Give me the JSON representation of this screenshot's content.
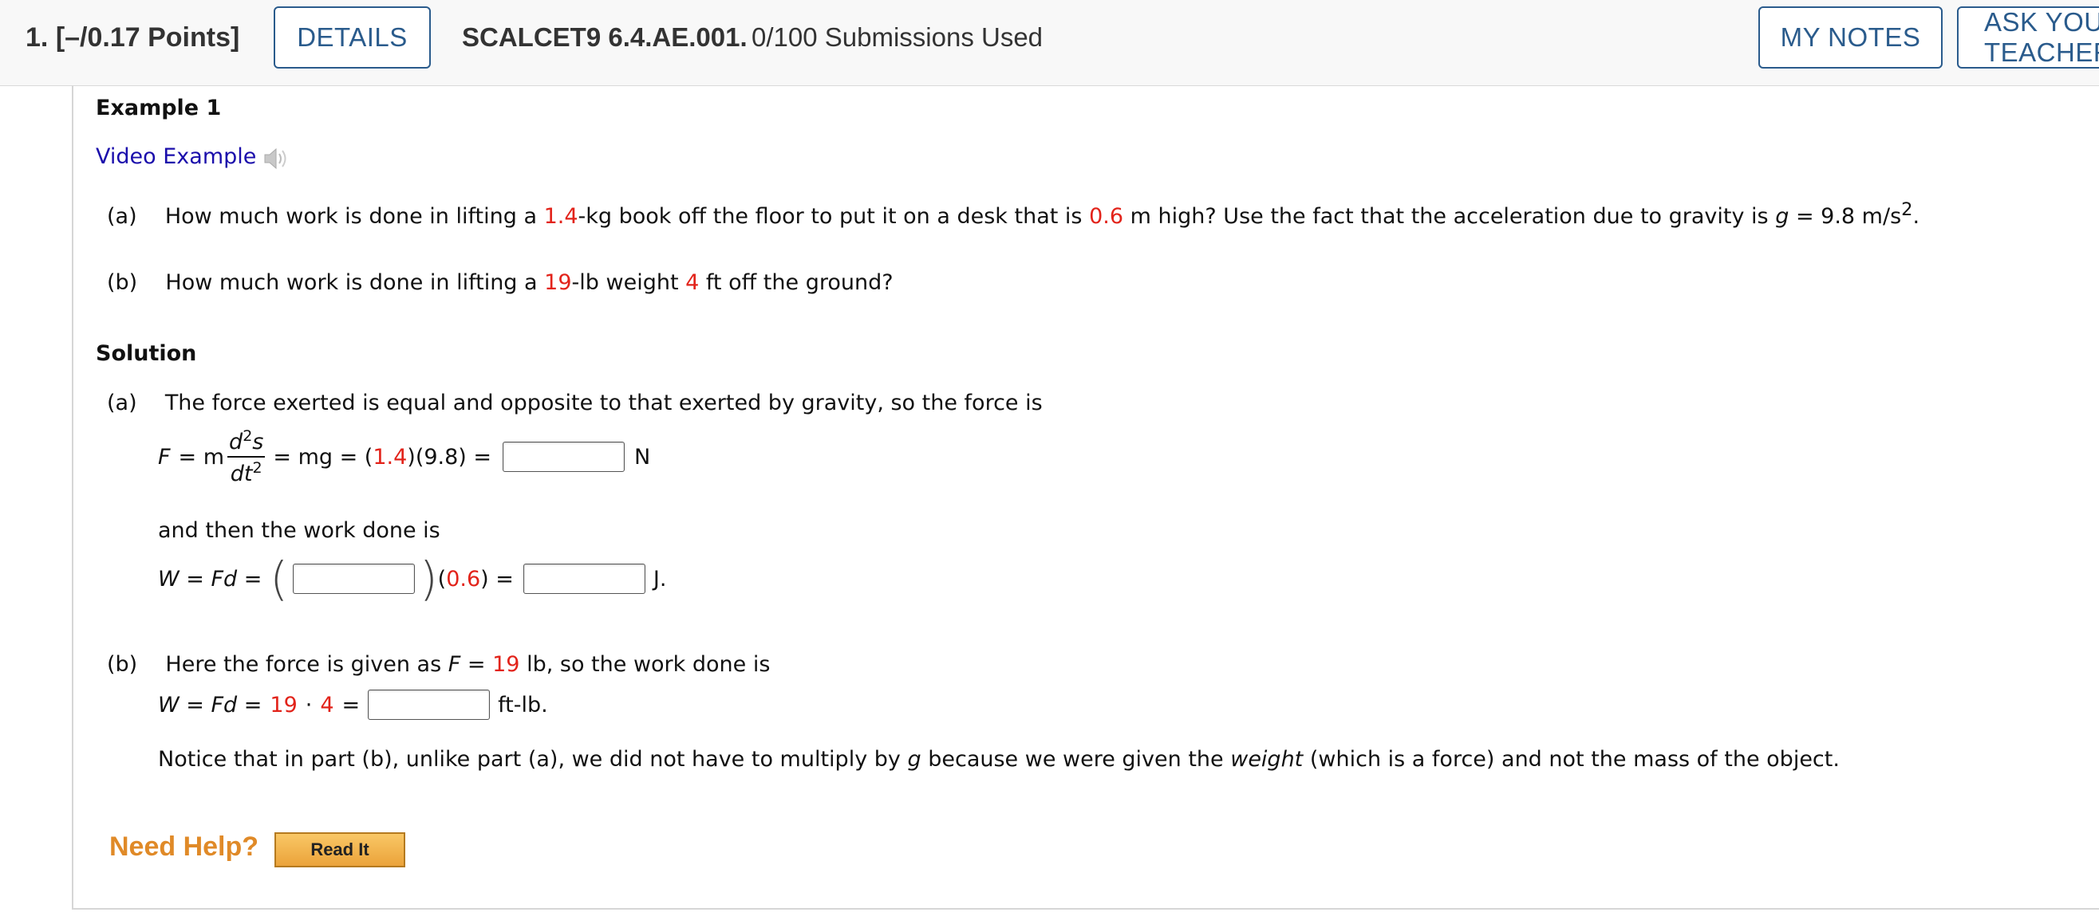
{
  "header": {
    "question_number": "1.",
    "points": "[–/0.17 Points]",
    "details_label": "DETAILS",
    "problem_code": "SCALCET9 6.4.AE.001.",
    "submissions": "0/100 Submissions Used",
    "my_notes_label": "MY NOTES",
    "ask_label": "ASK YOUR TEACHER"
  },
  "example": {
    "title": "Example 1",
    "video_link": "Video Example",
    "part_a_label": "(a)",
    "part_a_text_1": "How much work is done in lifting a",
    "part_a_mass": "1.4",
    "part_a_text_2": "-kg book off the floor to put it on a desk that is",
    "part_a_height": "0.6",
    "part_a_text_3": "m high? Use the fact that the acceleration due to gravity is",
    "part_a_g": "g",
    "part_a_text_4": "= 9.8 m/s",
    "part_a_exp": "2",
    "part_a_end": ".",
    "part_b_label": "(b)",
    "part_b_text_1": "How much work is done in lifting a",
    "part_b_weight": "19",
    "part_b_text_2": "-lb weight",
    "part_b_dist": "4",
    "part_b_text_3": "ft off the ground?"
  },
  "solution": {
    "title": "Solution",
    "a_label": "(a)",
    "a_intro": "The force exerted is equal and opposite to that exerted by gravity, so the force is",
    "eq1_F": "F",
    "eq1_eq_m": "= m",
    "eq1_num": "d",
    "eq1_num_sup": "2",
    "eq1_num_s": "s",
    "eq1_den": "dt",
    "eq1_den_sup": "2",
    "eq1_mg": "= mg = (",
    "eq1_mass": "1.4",
    "eq1_rest": ")(9.8) =",
    "eq1_unit": "N",
    "a_then": "and then the work done is",
    "eq2_W": "W = Fd =",
    "eq2_open": "(",
    "eq2_close": ")",
    "eq2_paren_open": "(",
    "eq2_height": "0.6",
    "eq2_rest": ") =",
    "eq2_unit": "J.",
    "b_label": "(b)",
    "b_text_1": "Here the force is given as",
    "b_F": "F",
    "b_eq": "=",
    "b_weight": "19",
    "b_text_2": "lb, so the work done is",
    "eq3_W": "W = Fd =",
    "eq3_weight": "19",
    "eq3_dot": "·",
    "eq3_dist": "4",
    "eq3_eq": "=",
    "eq3_unit": "ft-lb.",
    "notice_1": "Notice that in part (b), unlike part (a), we did not have to multiply by",
    "notice_g": "g",
    "notice_2": "because we were given the",
    "notice_weight": "weight",
    "notice_3": "(which is a force) and not the mass of the object."
  },
  "help": {
    "label": "Need Help?",
    "read_it": "Read It"
  },
  "colors": {
    "accent": "#2a5b8c",
    "given_value": "#e2231a",
    "help": "#e08a28"
  },
  "icons": {
    "video": "speaker-icon"
  }
}
